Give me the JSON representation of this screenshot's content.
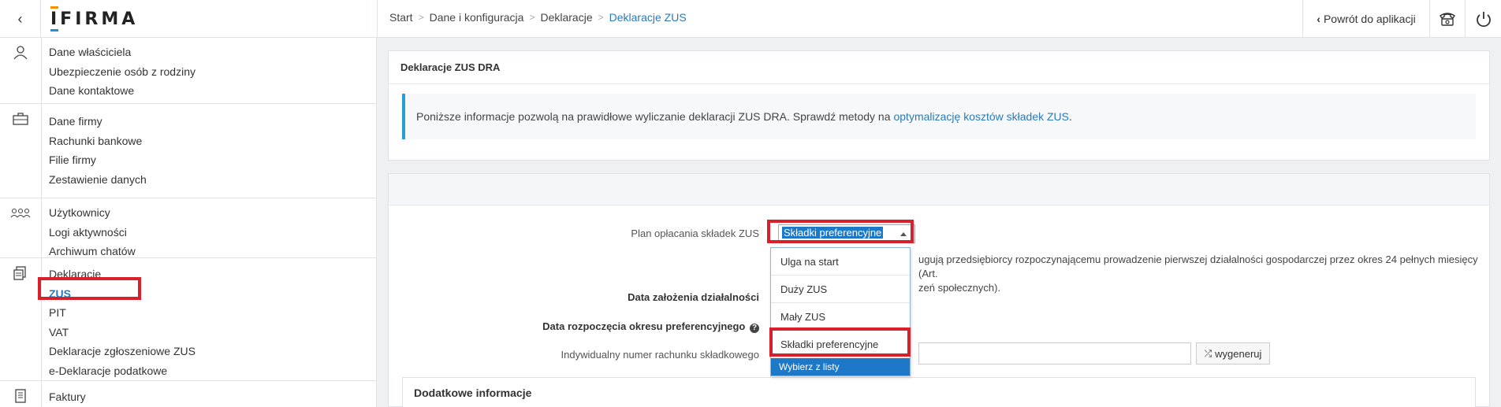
{
  "app": {
    "logo": "IFIRMA"
  },
  "topbar": {
    "breadcrumb": [
      "Start",
      "Dane i konfiguracja",
      "Deklaracje",
      "Deklaracje ZUS"
    ],
    "return_label": "Powrót do aplikacji"
  },
  "sidebar": {
    "groups": [
      {
        "icon": "person-icon",
        "items": [
          "Dane właściciela",
          "Ubezpieczenie osób z rodziny",
          "Dane kontaktowe"
        ]
      },
      {
        "icon": "briefcase-icon",
        "items": [
          "Dane firmy",
          "Rachunki bankowe",
          "Filie firmy",
          "Zestawienie danych"
        ]
      },
      {
        "icon": "users-icon",
        "items": [
          "Użytkownicy",
          "Logi aktywności",
          "Archiwum chatów"
        ]
      },
      {
        "icon": "documents-icon",
        "items": [
          "Deklaracje",
          "ZUS",
          "PIT",
          "VAT",
          "Deklaracje zgłoszeniowe ZUS",
          "e-Deklaracje podatkowe"
        ]
      },
      {
        "icon": "invoice-icon",
        "items": [
          "Faktury"
        ]
      }
    ],
    "active_item": "ZUS"
  },
  "panel1": {
    "title": "Deklaracje ZUS DRA",
    "info_text": "Poniższe informacje pozwolą na prawidłowe wyliczanie deklaracji ZUS DRA. Sprawdź metody na",
    "info_link": "optymalizację kosztów składek ZUS",
    "info_end": "."
  },
  "form": {
    "plan_label": "Plan opłacania składek ZUS",
    "plan_value": "Składki preferencyjne",
    "help_text_line1": "ugują przedsiębiorcy rozpoczynającemu prowadzenie pierwszej działalności gospodarczej przez okres 24 pełnych miesięcy (Art.",
    "help_text_line2": "zeń społecznych).",
    "start_date_label": "Data założenia działalności",
    "pref_start_label": "Data rozpoczęcia okresu preferencyjnego",
    "account_label": "Indywidualny numer rachunku składkowego",
    "generate_label": "wygeneruj",
    "extra_title": "Dodatkowe informacje"
  },
  "dropdown": {
    "options": [
      "Ulga na start",
      "Duży ZUS",
      "Mały ZUS",
      "Składki preferencyjne"
    ],
    "footer": "Wybierz z listy"
  },
  "colors": {
    "accent": "#2a7ab8",
    "highlight": "#d7202a",
    "select_blue": "#1e78c8"
  }
}
